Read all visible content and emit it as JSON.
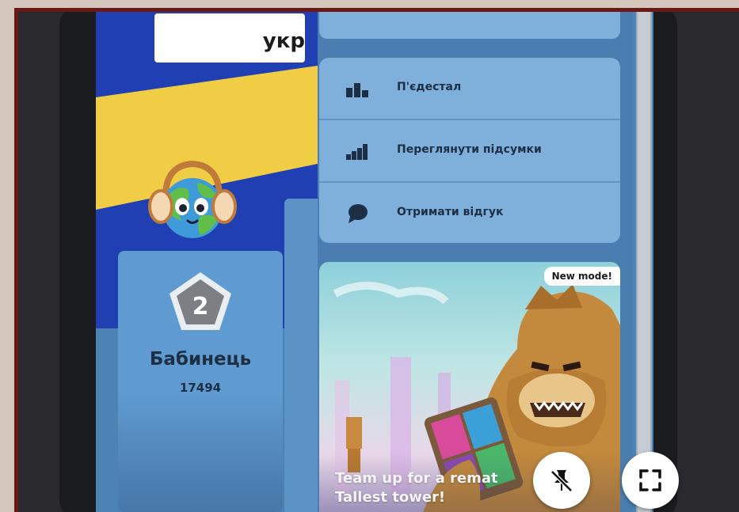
{
  "quiz": {
    "title_fragment": "укр"
  },
  "podium": {
    "rank": "2",
    "player_name": "Бабинець",
    "player_score": "17494"
  },
  "menu": {
    "items": [
      {
        "label": "П'єдестал",
        "icon": "podium-icon"
      },
      {
        "label": "Переглянути підсумки",
        "icon": "bar-chart-icon"
      },
      {
        "label": "Отримати відгук",
        "icon": "chat-bubble-icon"
      }
    ]
  },
  "promo": {
    "badge": "New mode!",
    "line1": "Team up for a remat",
    "line2": "Tallest tower!"
  },
  "controls": {
    "unpin_icon": "unpin-icon",
    "fullscreen_icon": "fullscreen-icon"
  },
  "colors": {
    "panel": "#4a7eb0",
    "menu_card": "#7fb0dc",
    "podium_blue": "#1f3fb2",
    "podium_yellow": "#f0cd45",
    "frame": "#6a1a14"
  }
}
